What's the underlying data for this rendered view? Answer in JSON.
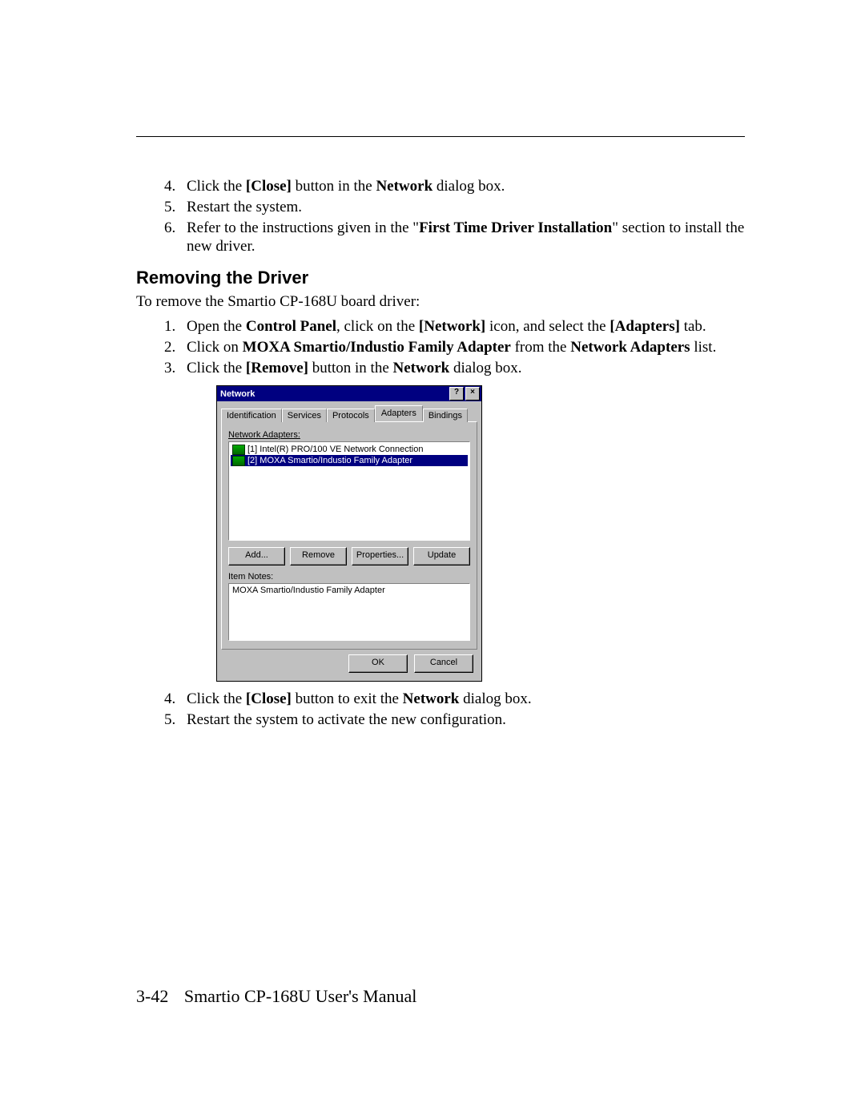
{
  "steps_top": [
    {
      "n": "4.",
      "html": "Click the <b>[Close]</b> button in the <b>Network</b> dialog box."
    },
    {
      "n": "5.",
      "html": "Restart the system."
    },
    {
      "n": "6.",
      "html": "Refer to the instructions given in the \"<b>First Time Driver Installation</b>\" section to install the new driver."
    }
  ],
  "heading": "Removing the Driver",
  "intro": "To remove the Smartio CP-168U board driver:",
  "steps_mid": [
    {
      "n": "1.",
      "html": "Open the <b>Control Panel</b>, click on the <b>[Network]</b> icon, and select the <b>[Adapters]</b> tab."
    },
    {
      "n": "2.",
      "html": "Click on <b>MOXA Smartio/Industio Family Adapter</b> from the <b>Network Adapters</b> list."
    },
    {
      "n": "3.",
      "html": "Click the <b>[Remove]</b> button in the <b>Network</b> dialog box."
    }
  ],
  "dialog": {
    "title": "Network",
    "help": "?",
    "close": "×",
    "tabs": [
      "Identification",
      "Services",
      "Protocols",
      "Adapters",
      "Bindings"
    ],
    "active_tab": 3,
    "adapters_label": "Network Adapters:",
    "adapters": [
      {
        "text": "[1] Intel(R) PRO/100 VE Network Connection",
        "selected": false
      },
      {
        "text": "[2] MOXA Smartio/Industio Family Adapter",
        "selected": true
      }
    ],
    "buttons": {
      "add": "Add...",
      "remove": "Remove",
      "properties": "Properties...",
      "update": "Update"
    },
    "item_notes_label": "Item Notes:",
    "item_notes": "MOXA Smartio/Industio Family Adapter",
    "ok": "OK",
    "cancel": "Cancel"
  },
  "steps_bottom": [
    {
      "n": "4.",
      "html": "Click the <b>[Close]</b> button to exit the <b>Network</b> dialog box."
    },
    {
      "n": "5.",
      "html": "Restart the system to activate the new configuration."
    }
  ],
  "footer": {
    "page": "3-42",
    "title": "Smartio CP-168U User's Manual"
  }
}
